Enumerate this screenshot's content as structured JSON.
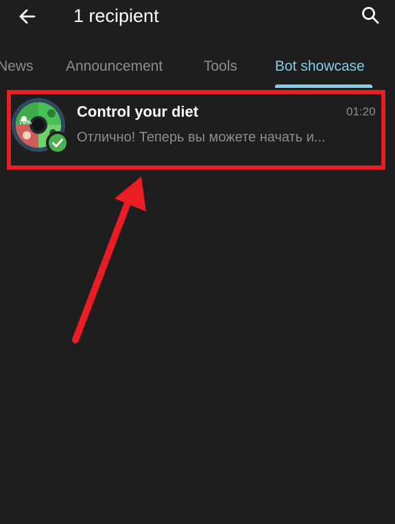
{
  "header": {
    "title": "1 recipient",
    "back_icon": "arrow-left-icon",
    "search_icon": "search-icon"
  },
  "tabs": [
    {
      "label": "News",
      "active": false
    },
    {
      "label": "Announcement",
      "active": false
    },
    {
      "label": "Tools",
      "active": false
    },
    {
      "label": "Bot showcase",
      "active": true
    }
  ],
  "chat": {
    "name": "Control your diet",
    "time": "01:20",
    "preview": "Отлично! Теперь вы можете начать и...",
    "avatar_badge_text": "70%",
    "verified": true
  },
  "colors": {
    "background": "#1e1e1e",
    "accent": "#86cde6",
    "muted_text": "#8d8d8d",
    "highlight": "#ea1c24",
    "verified_badge": "#4caf50"
  }
}
